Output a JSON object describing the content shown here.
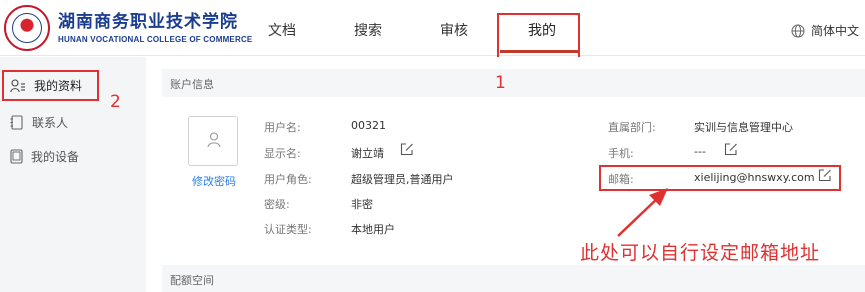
{
  "header": {
    "logo_cn": "湖南商务职业技术学院",
    "logo_en": "HUNAN VOCATIONAL COLLEGE OF COMMERCE",
    "nav": [
      {
        "label": "文档"
      },
      {
        "label": "搜索"
      },
      {
        "label": "审核"
      },
      {
        "label": "我的",
        "active": true
      }
    ],
    "language": "简体中文"
  },
  "sidebar": {
    "items": [
      {
        "label": "我的资料",
        "icon": "user-list-icon",
        "active": true
      },
      {
        "label": "联系人",
        "icon": "address-book-icon"
      },
      {
        "label": "我的设备",
        "icon": "tablet-icon"
      }
    ]
  },
  "account": {
    "section_title": "账户信息",
    "change_password": "修改密码",
    "fields_left": [
      {
        "label": "用户名:",
        "value": "00321"
      },
      {
        "label": "显示名:",
        "value": "谢立靖"
      },
      {
        "label": "用户角色:",
        "value": "超级管理员,普通用户"
      },
      {
        "label": "密级:",
        "value": "非密"
      },
      {
        "label": "认证类型:",
        "value": "本地用户"
      }
    ],
    "fields_right": [
      {
        "label": "直属部门:",
        "value": "实训与信息管理中心"
      },
      {
        "label": "手机:",
        "value": "---"
      },
      {
        "label": "邮箱:",
        "value": "xielijing@hnswxy.com"
      }
    ]
  },
  "quota": {
    "section_title": "配额空间"
  },
  "annotations": {
    "step1": "1",
    "step2": "2",
    "note": "此处可以自行设定邮箱地址"
  },
  "colors": {
    "accent": "#c0392b",
    "annotation": "#e03131",
    "link": "#2b7de9",
    "logo_blue": "#1b3d8f"
  }
}
